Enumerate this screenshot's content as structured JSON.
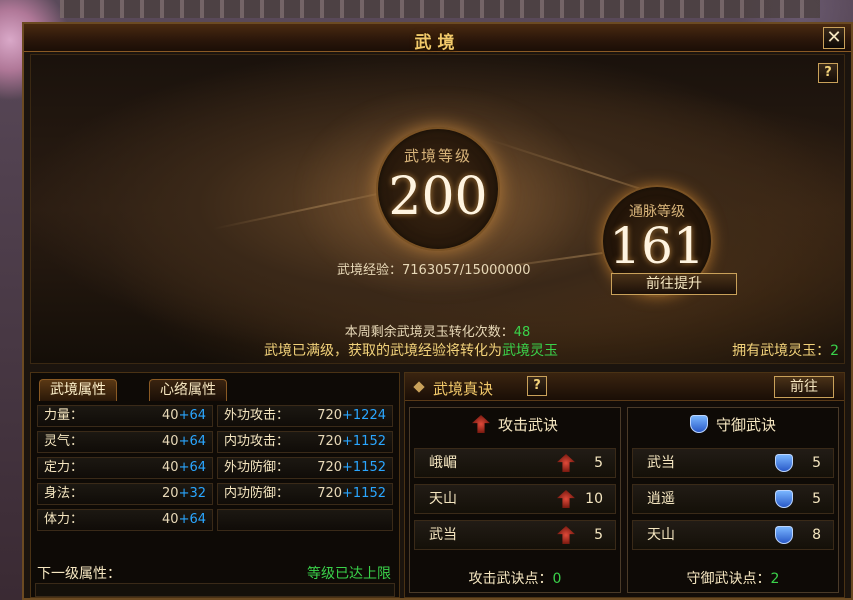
{
  "window": {
    "title": "武境",
    "close_glyph": "✕",
    "help_glyph": "?"
  },
  "art": {
    "realm_level_label": "武境等级",
    "realm_level_value": "200",
    "meridian_level_label": "通脉等级",
    "meridian_level_value": "161",
    "exp_label": "武境经验：",
    "exp_value": "7163057/15000000",
    "goto_label": "前往提升",
    "week_prefix": "本周剩余武境灵玉转化次数：",
    "week_value": "48",
    "notice_prefix": "武境已满级，获取的武境经验将转化为",
    "notice_highlight": "武境灵玉",
    "owned_label": "拥有武境灵玉：",
    "owned_value": "2"
  },
  "attrs": {
    "tabs": [
      {
        "label": "武境属性"
      },
      {
        "label": "心络属性"
      }
    ],
    "left": [
      {
        "key": "力量：",
        "base": "40",
        "plus": "+64"
      },
      {
        "key": "灵气：",
        "base": "40",
        "plus": "+64"
      },
      {
        "key": "定力：",
        "base": "40",
        "plus": "+64"
      },
      {
        "key": "身法：",
        "base": "20",
        "plus": "+32"
      },
      {
        "key": "体力：",
        "base": "40",
        "plus": "+64"
      }
    ],
    "right": [
      {
        "key": "外功攻击：",
        "base": "720",
        "plus": "+1224"
      },
      {
        "key": "内功攻击：",
        "base": "720",
        "plus": "+1152"
      },
      {
        "key": "外功防御：",
        "base": "720",
        "plus": "+1152"
      },
      {
        "key": "内功防御：",
        "base": "720",
        "plus": "+1152"
      }
    ],
    "next_label": "下一级属性：",
    "maxed_label": "等级已达上限"
  },
  "skills": {
    "title": "武境真诀",
    "go_label": "前往",
    "attack": {
      "title": "攻击武诀",
      "rows": [
        {
          "name": "峨嵋",
          "count": "5"
        },
        {
          "name": "天山",
          "count": "10"
        },
        {
          "name": "武当",
          "count": "5"
        }
      ],
      "points_label": "攻击武诀点：",
      "points_value": "0"
    },
    "defense": {
      "title": "守御武诀",
      "rows": [
        {
          "name": "武当",
          "count": "5"
        },
        {
          "name": "逍遥",
          "count": "5"
        },
        {
          "name": "天山",
          "count": "8"
        }
      ],
      "points_label": "守御武诀点：",
      "points_value": "2"
    }
  },
  "colors": {
    "accent_gold": "#f2c96a",
    "green": "#3ad24a",
    "blue_plus": "#2aa6ff"
  }
}
